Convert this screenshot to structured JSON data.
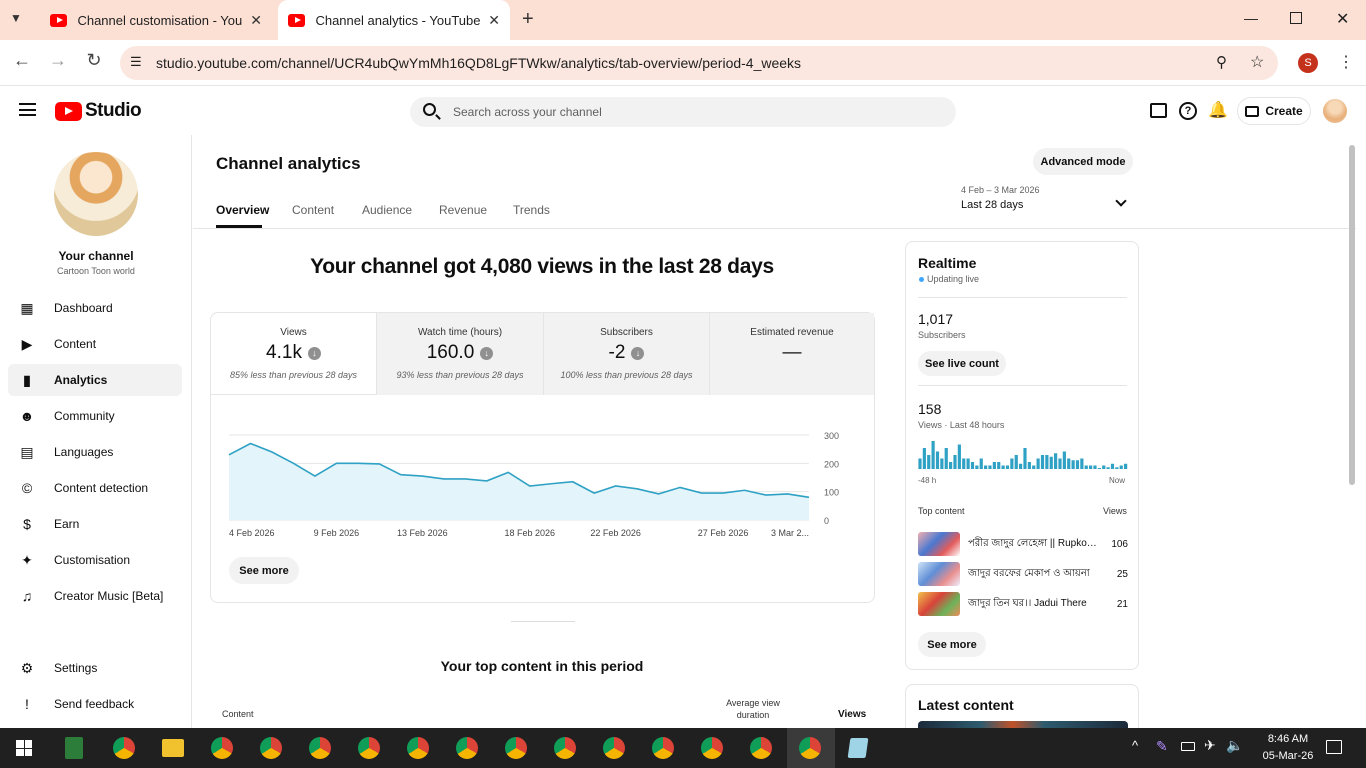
{
  "browser": {
    "tabs": [
      {
        "title": "Channel customisation - YouTube Studio",
        "active": false
      },
      {
        "title": "Channel analytics - YouTube Studio",
        "active": true
      }
    ],
    "url": "studio.youtube.com/channel/UCR4ubQwYmMh16QD8LgFTWkw/analytics/tab-overview/period-4_weeks",
    "profile_initial": "S"
  },
  "header": {
    "logo": "Studio",
    "search_placeholder": "Search across your channel",
    "create_label": "Create"
  },
  "sidebar": {
    "channel_label": "Your channel",
    "channel_name": "Cartoon Toon world",
    "items": [
      {
        "label": "Dashboard",
        "icon": "dashboard-icon"
      },
      {
        "label": "Content",
        "icon": "content-icon"
      },
      {
        "label": "Analytics",
        "icon": "analytics-icon",
        "selected": true
      },
      {
        "label": "Community",
        "icon": "community-icon"
      },
      {
        "label": "Languages",
        "icon": "languages-icon"
      },
      {
        "label": "Content detection",
        "icon": "copyright-icon"
      },
      {
        "label": "Earn",
        "icon": "earn-icon"
      },
      {
        "label": "Customisation",
        "icon": "customisation-icon"
      },
      {
        "label": "Creator Music [Beta]",
        "icon": "music-icon"
      }
    ],
    "settings": "Settings",
    "feedback": "Send feedback"
  },
  "analytics": {
    "title": "Channel analytics",
    "advanced_mode": "Advanced mode",
    "tabs": [
      "Overview",
      "Content",
      "Audience",
      "Revenue",
      "Trends"
    ],
    "date_range": "4 Feb – 3 Mar 2026",
    "period": "Last 28 days",
    "headline": "Your channel got 4,080 views in the last 28 days",
    "metrics": [
      {
        "label": "Views",
        "value": "4.1k",
        "note": "85% less than previous 28 days"
      },
      {
        "label": "Watch time (hours)",
        "value": "160.0",
        "note": "93% less than previous 28 days"
      },
      {
        "label": "Subscribers",
        "value": "-2",
        "note": "100% less than previous 28 days"
      },
      {
        "label": "Estimated revenue",
        "value": "—",
        "note": ""
      }
    ],
    "see_more": "See more",
    "top_content_title": "Your top content in this period",
    "table_headers": [
      "Content",
      "Average view duration",
      "Views"
    ]
  },
  "chart_data": {
    "type": "area",
    "x": [
      "4 Feb 2026",
      "5 Feb 2026",
      "6 Feb 2026",
      "7 Feb 2026",
      "8 Feb 2026",
      "9 Feb 2026",
      "10 Feb 2026",
      "11 Feb 2026",
      "12 Feb 2026",
      "13 Feb 2026",
      "14 Feb 2026",
      "15 Feb 2026",
      "16 Feb 2026",
      "17 Feb 2026",
      "18 Feb 2026",
      "19 Feb 2026",
      "20 Feb 2026",
      "21 Feb 2026",
      "22 Feb 2026",
      "23 Feb 2026",
      "24 Feb 2026",
      "25 Feb 2026",
      "26 Feb 2026",
      "27 Feb 2026",
      "28 Feb 2026",
      "1 Mar 2026",
      "2 Mar 2026",
      "3 Mar 2026"
    ],
    "series": [
      {
        "values": [
          230,
          270,
          240,
          200,
          155,
          200,
          200,
          198,
          160,
          155,
          145,
          145,
          138,
          168,
          120,
          128,
          135,
          95,
          120,
          110,
          92,
          115,
          95,
          95,
          105,
          88,
          92,
          80
        ]
      }
    ],
    "x_tick_labels": [
      "4 Feb 2026",
      "9 Feb 2026",
      "13 Feb 2026",
      "18 Feb 2026",
      "22 Feb 2026",
      "27 Feb 2026",
      "3 Mar 2..."
    ],
    "y_ticks": [
      0,
      100,
      200,
      300
    ],
    "ylim": [
      0,
      300
    ],
    "grid": true
  },
  "realtime": {
    "title": "Realtime",
    "status": "Updating live",
    "subscribers": "1,017",
    "subscribers_label": "Subscribers",
    "see_live": "See live count",
    "views": "158",
    "views_label": "Views · Last 48 hours",
    "bars": [
      6,
      12,
      8,
      16,
      10,
      6,
      12,
      4,
      8,
      14,
      6,
      6,
      4,
      2,
      6,
      2,
      2,
      4,
      4,
      2,
      2,
      6,
      8,
      3,
      12,
      4,
      2,
      6,
      8,
      8,
      7,
      9,
      6,
      10,
      6,
      5,
      5,
      6,
      2,
      2,
      2,
      0,
      2,
      1,
      3,
      1,
      2,
      3
    ],
    "axis_start": "-48 h",
    "axis_end": "Now",
    "top_content_label": "Top content",
    "views_col": "Views",
    "top_content": [
      {
        "title": "পরীর জাদুর লেহেঙ্গা || Rupkotha",
        "views": "106"
      },
      {
        "title": "জাদুর বরফের মেকাপ ও আয়না",
        "views": "25"
      },
      {
        "title": "জাদুর তিন ঘর।। Jadui There",
        "views": "21"
      }
    ],
    "see_more": "See more",
    "latest_content": "Latest content"
  },
  "taskbar": {
    "time": "8:46 AM",
    "date": "05-Mar-26"
  },
  "colors": {
    "accent": "#ff0000",
    "chart_line": "#2ea1c4",
    "chart_fill": "#e3f4fa",
    "live_dot": "#3ea6ff"
  }
}
